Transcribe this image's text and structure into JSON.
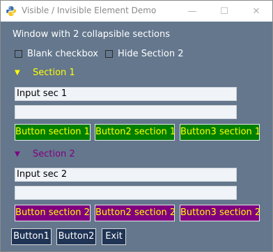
{
  "window": {
    "title": "Visible / Invisible Element Demo",
    "controls": {
      "minimize": "—",
      "maximize": "☐",
      "close": "✕"
    }
  },
  "header_text": "Window with 2 collapsible sections",
  "checkboxes": [
    {
      "label": "Blank checkbox",
      "checked": false
    },
    {
      "label": "Hide Section 2",
      "checked": false
    }
  ],
  "section1": {
    "arrow": "▼",
    "title": "Section 1",
    "inputs": [
      "Input sec 1",
      ""
    ],
    "buttons": [
      "Button section 1",
      "Button2 section 1",
      "Button3 section 1"
    ],
    "title_color": "#ffff00",
    "button_color": "#008000"
  },
  "section2": {
    "arrow": "▼",
    "title": "Section 2",
    "inputs": [
      "Input sec 2",
      ""
    ],
    "buttons": [
      "Button section 2",
      "Button2 section 2",
      "Button3 section 2"
    ],
    "title_color": "#800080",
    "button_color": "#800080"
  },
  "bottom_buttons": [
    "Button1",
    "Button2",
    "Exit"
  ],
  "colors": {
    "background": "#64778d",
    "button_text": "#ffff00",
    "bottom_button_bg": "#1f3354"
  }
}
